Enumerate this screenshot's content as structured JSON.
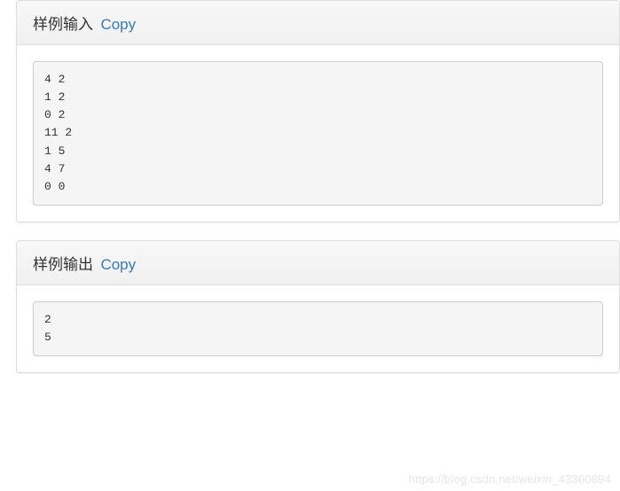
{
  "sections": [
    {
      "title": "样例输入",
      "copy_label": "Copy",
      "content": "4 2\n1 2\n0 2\n11 2\n1 5\n4 7\n0 0"
    },
    {
      "title": "样例输出",
      "copy_label": "Copy",
      "content": "2\n5"
    }
  ],
  "watermark": "https://blog.csdn.net/weixin_43300894"
}
